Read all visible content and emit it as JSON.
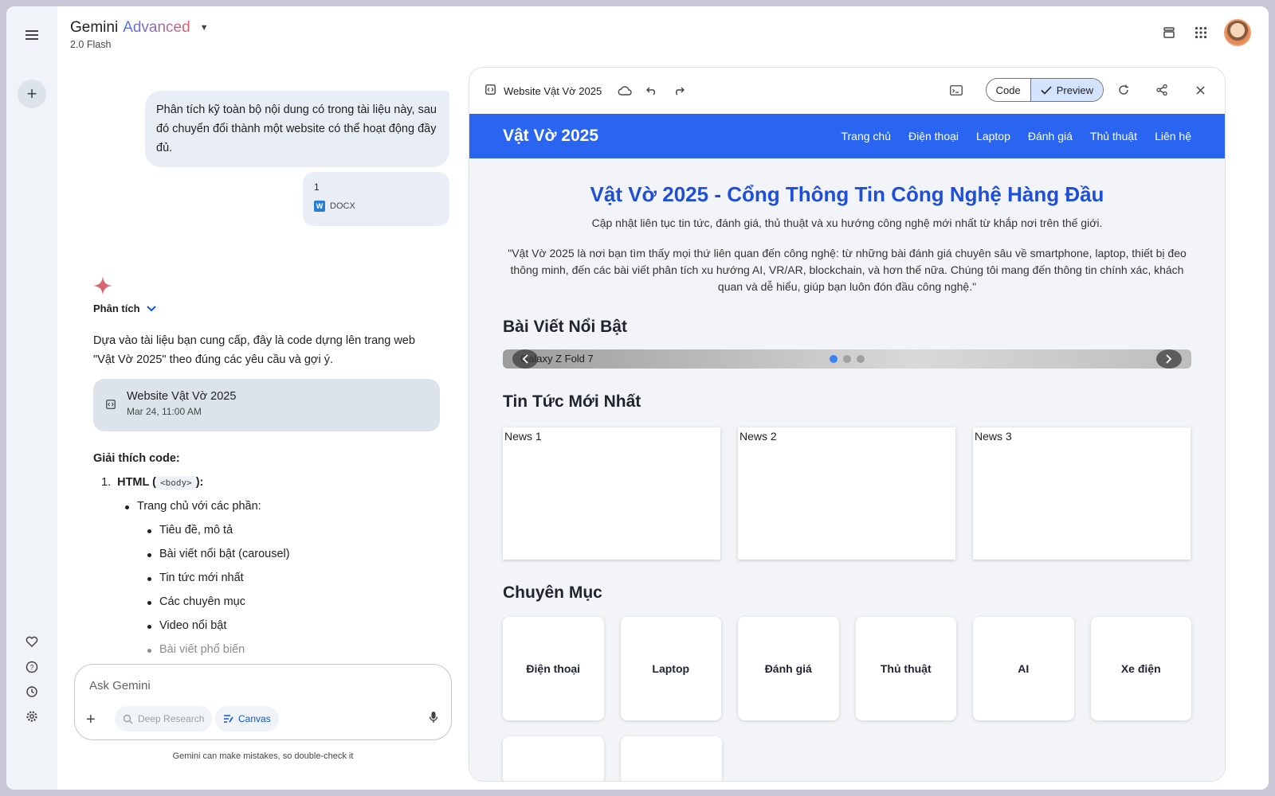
{
  "app": {
    "name": "Gemini",
    "tier": "Advanced",
    "model": "2.0 Flash"
  },
  "chat": {
    "user_message": "Phân tích kỹ toàn bộ nội dung có trong tài liệu này, sau đó chuyển đổi thành một website có thể hoạt động đầy đủ.",
    "attachment": {
      "name": "1",
      "type": "DOCX"
    },
    "analysis_label": "Phân tích",
    "response_intro": "Dựa vào tài liệu bạn cung cấp, đây là code dựng lên trang web \"Vật Vờ 2025\" theo đúng các yêu cầu và gợi ý.",
    "artifact": {
      "title": "Website Vật Vờ 2025",
      "date": "Mar 24, 11:00 AM"
    },
    "explain_heading": "Giải thích code:",
    "explain_item1_num": "1.",
    "explain_item1_label": "HTML (",
    "explain_item1_code": "<body>",
    "explain_item1_end": "):",
    "explain_sub": "Trang chủ với các phần:",
    "explain_parts": [
      "Tiêu đề, mô tả",
      "Bài viết nổi bật (carousel)",
      "Tin tức mới nhất",
      "Các chuyên mục",
      "Video nổi bật",
      "Bài viết phổ biến"
    ]
  },
  "input": {
    "placeholder": "Ask Gemini",
    "deep_research": "Deep Research",
    "canvas": "Canvas",
    "disclaimer": "Gemini can make mistakes, so double-check it"
  },
  "panel": {
    "title": "Website Vật Vờ 2025",
    "code_label": "Code",
    "preview_label": "Preview"
  },
  "site": {
    "logo": "Vật Vờ 2025",
    "nav": [
      "Trang chủ",
      "Điện thoại",
      "Laptop",
      "Đánh giá",
      "Thủ thuật",
      "Liên hệ"
    ],
    "hero_title": "Vật Vờ 2025 - Cổng Thông Tin Công Nghệ Hàng Đầu",
    "hero_sub": "Cập nhật liên tục tin tức, đánh giá, thủ thuật và xu hướng công nghệ mới nhất từ khắp nơi trên thế giới.",
    "hero_quote": "\"Vật Vờ 2025 là nơi bạn tìm thấy mọi thứ liên quan đến công nghệ: từ những bài đánh giá chuyên sâu về smartphone, laptop, thiết bị đeo thông minh, đến các bài viết phân tích xu hướng AI, VR/AR, blockchain, và hơn thế nữa. Chúng tôi mang đến thông tin chính xác, khách quan và dễ hiểu, giúp bạn luôn đón đầu công nghệ.\"",
    "featured_heading": "Bài Viết Nổi Bật",
    "carousel_caption": "Galaxy Z Fold 7",
    "news_heading": "Tin Tức Mới Nhất",
    "news": [
      "News 1",
      "News 2",
      "News 3"
    ],
    "categories_heading": "Chuyên Mục",
    "categories": [
      "Điện thoại",
      "Laptop",
      "Đánh giá",
      "Thủ thuật",
      "AI",
      "Xe điện"
    ],
    "accent_color": "#2965f1"
  }
}
